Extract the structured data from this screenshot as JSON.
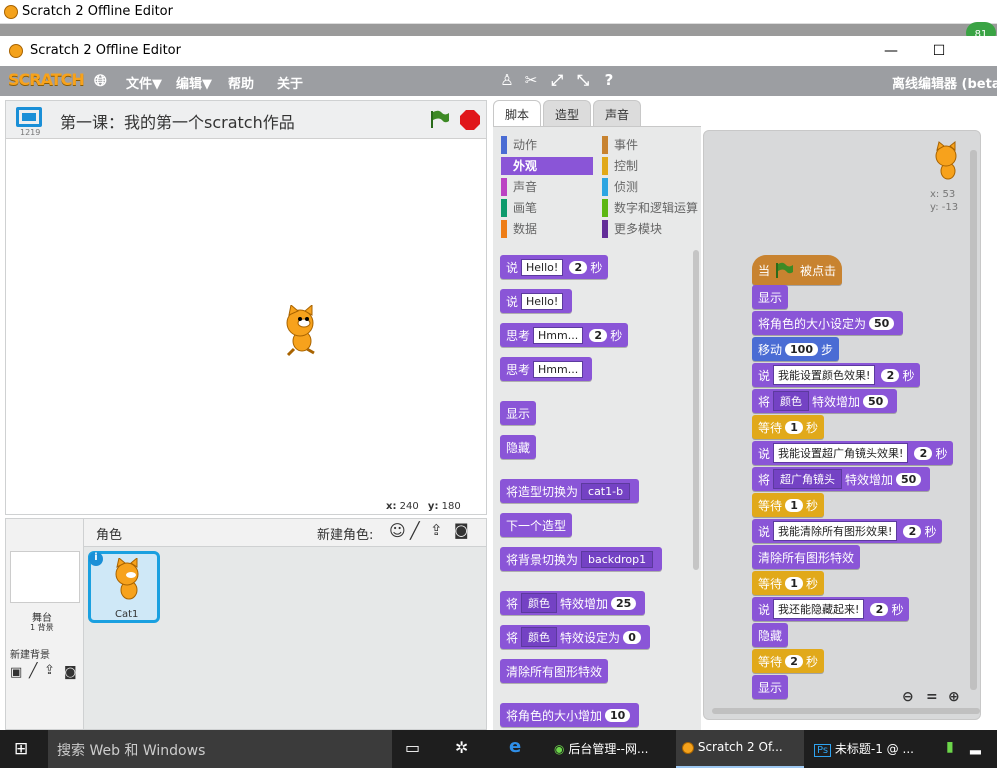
{
  "bg_window": {
    "title": "Scratch 2 Offline Editor"
  },
  "window": {
    "title": "Scratch 2 Offline Editor",
    "minimize": "—",
    "maximize": "☐"
  },
  "menubar": {
    "logo": "SCRATCH",
    "items": [
      "文件▼",
      "编辑▼",
      "帮助",
      "关于"
    ],
    "right_text": "离线编辑器 (beta"
  },
  "stage": {
    "project_title": "第一课：我的第一个scratch作品",
    "version": "1219",
    "coords_x_label": "x:",
    "coords_x": "240",
    "coords_y_label": "y:",
    "coords_y": "180"
  },
  "sprites": {
    "header": "角色",
    "new_sprite_label": "新建角色:",
    "stage_label": "舞台",
    "stage_count": "1 背景",
    "new_backdrop_label": "新建背景",
    "sprite_name": "Cat1"
  },
  "tabs": [
    "脚本",
    "造型",
    "声音"
  ],
  "categories": {
    "left": [
      {
        "label": "动作",
        "color": "#4a6cd4"
      },
      {
        "label": "外观",
        "color": "#8a55d7"
      },
      {
        "label": "声音",
        "color": "#bb42c3"
      },
      {
        "label": "画笔",
        "color": "#0e9a6c"
      },
      {
        "label": "数据",
        "color": "#ee7d16"
      }
    ],
    "right": [
      {
        "label": "事件",
        "color": "#c88330"
      },
      {
        "label": "控制",
        "color": "#e1a91a"
      },
      {
        "label": "侦测",
        "color": "#2ca5e2"
      },
      {
        "label": "数字和逻辑运算",
        "color": "#5cb712"
      },
      {
        "label": "更多模块",
        "color": "#632d99"
      }
    ]
  },
  "palette": {
    "say_secs": {
      "say": "说",
      "text": "Hello!",
      "num": "2",
      "unit": "秒"
    },
    "say": {
      "say": "说",
      "text": "Hello!"
    },
    "think_secs": {
      "think": "思考",
      "text": "Hmm...",
      "num": "2",
      "unit": "秒"
    },
    "think": {
      "think": "思考",
      "text": "Hmm..."
    },
    "show": "显示",
    "hide": "隐藏",
    "switch_costume": {
      "label": "将造型切换为",
      "value": "cat1-b"
    },
    "next_costume": "下一个造型",
    "switch_backdrop": {
      "label": "将背景切换为",
      "value": "backdrop1"
    },
    "change_effect": {
      "pre": "将",
      "effect": "颜色",
      "label": "特效增加",
      "num": "25"
    },
    "set_effect": {
      "pre": "将",
      "effect": "颜色",
      "label": "特效设定为",
      "num": "0"
    },
    "clear_effects": "清除所有图形特效",
    "change_size": {
      "label": "将角色的大小增加",
      "num": "10"
    }
  },
  "script": {
    "sprite_x": "x: 53",
    "sprite_y": "y: -13",
    "hat": {
      "when": "当",
      "clicked": "被点击"
    },
    "b1": "显示",
    "b2": {
      "label": "将角色的大小设定为",
      "num": "50"
    },
    "b3": {
      "label": "移动",
      "num": "100",
      "unit": "步"
    },
    "b4": {
      "say": "说",
      "text": "我能设置颜色效果!",
      "num": "2",
      "unit": "秒"
    },
    "b5": {
      "pre": "将",
      "effect": "颜色",
      "label": "特效增加",
      "num": "50"
    },
    "b6": {
      "label": "等待",
      "num": "1",
      "unit": "秒"
    },
    "b7": {
      "say": "说",
      "text": "我能设置超广角镜头效果!",
      "num": "2",
      "unit": "秒"
    },
    "b8": {
      "pre": "将",
      "effect": "超广角镜头",
      "label": "特效增加",
      "num": "50"
    },
    "b9": {
      "label": "等待",
      "num": "1",
      "unit": "秒"
    },
    "b10": {
      "say": "说",
      "text": "我能清除所有图形效果!",
      "num": "2",
      "unit": "秒"
    },
    "b11": "清除所有图形特效",
    "b12": {
      "label": "等待",
      "num": "1",
      "unit": "秒"
    },
    "b13": {
      "say": "说",
      "text": "我还能隐藏起来!",
      "num": "2",
      "unit": "秒"
    },
    "b14": "隐藏",
    "b15": {
      "label": "等待",
      "num": "2",
      "unit": "秒"
    },
    "b16": "显示"
  },
  "taskbar": {
    "search": "搜索 Web 和 Windows",
    "items": [
      "后台管理--网...",
      "Scratch 2 Of...",
      "未标题-1 @ ..."
    ],
    "badge": "81"
  }
}
